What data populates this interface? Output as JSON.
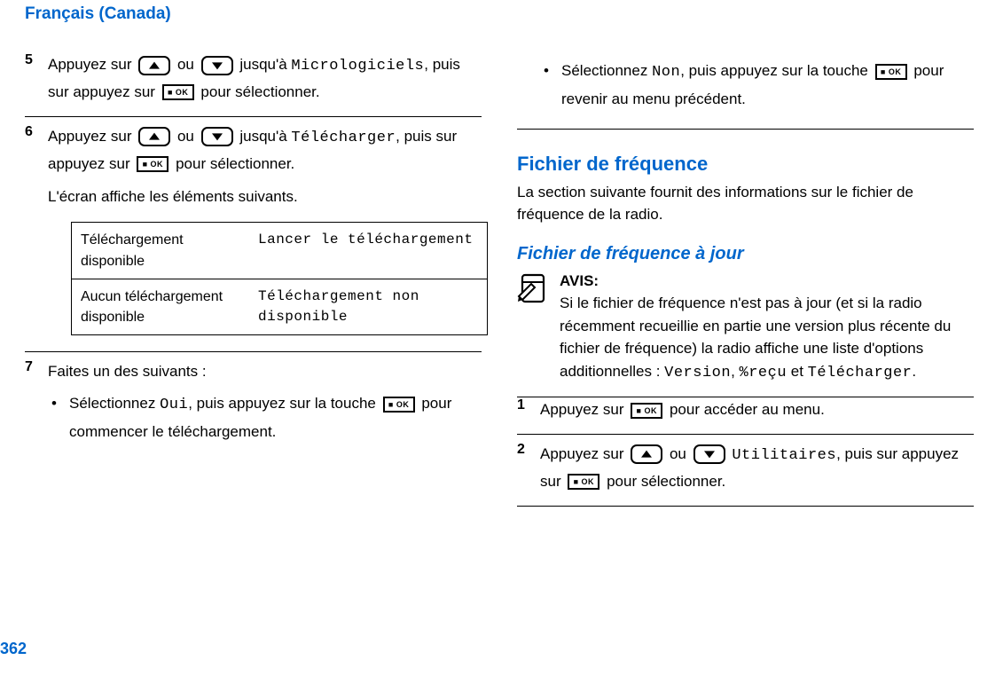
{
  "header": {
    "language": "Français (Canada)"
  },
  "page_number": "362",
  "left": {
    "step5": {
      "num": "5",
      "t1": "Appuyez sur ",
      "t2": " ou ",
      "t3": " jusqu'à ",
      "term1": "Micrologiciels",
      "t4": ", puis sur appuyez sur ",
      "t5": " pour sélectionner."
    },
    "step6": {
      "num": "6",
      "t1": "Appuyez sur ",
      "t2": " ou ",
      "t3": " jusqu'à ",
      "term1": "Télécharger",
      "t4": ", puis sur appuyez sur ",
      "t5": " pour sélectionner.",
      "line2": "L'écran affiche les éléments suivants."
    },
    "table": {
      "r1c1": "Téléchargement disponible",
      "r1c2": "Lancer le téléchargement",
      "r2c1": "Aucun téléchargement disponible",
      "r2c2": "Téléchargement non disponible"
    },
    "step7": {
      "num": "7",
      "intro": "Faites un des suivants :",
      "b1a": "Sélectionnez ",
      "b1term": "Oui",
      "b1b": ", puis appuyez sur la touche ",
      "b1c": " pour commencer le téléchargement."
    }
  },
  "right": {
    "topBullet": {
      "a": "Sélectionnez ",
      "term": "Non",
      "b": ", puis appuyez sur la touche ",
      "c": " pour revenir au menu précédent."
    },
    "heading": "Fichier de fréquence",
    "para": "La section suivante fournit des informations sur le fichier de fréquence de la radio.",
    "subheading": "Fichier de fréquence à jour",
    "notice": {
      "label": "AVIS:",
      "body_a": "Si le fichier de fréquence n'est pas à jour (et si la radio récemment recueillie en partie une version plus récente du fichier de fréquence) la radio affiche une liste d'options additionnelles : ",
      "term1": "Version",
      "sep1": ", ",
      "term2": "%reçu",
      "sep2": " et ",
      "term3": "Télécharger",
      "end": "."
    },
    "step1": {
      "num": "1",
      "a": "Appuyez sur ",
      "b": " pour accéder au menu."
    },
    "step2": {
      "num": "2",
      "a": "Appuyez sur ",
      "b": " ou ",
      "c": " ",
      "term": "Utilitaires",
      "d": ", puis sur appuyez sur ",
      "e": " pour sélectionner."
    }
  }
}
